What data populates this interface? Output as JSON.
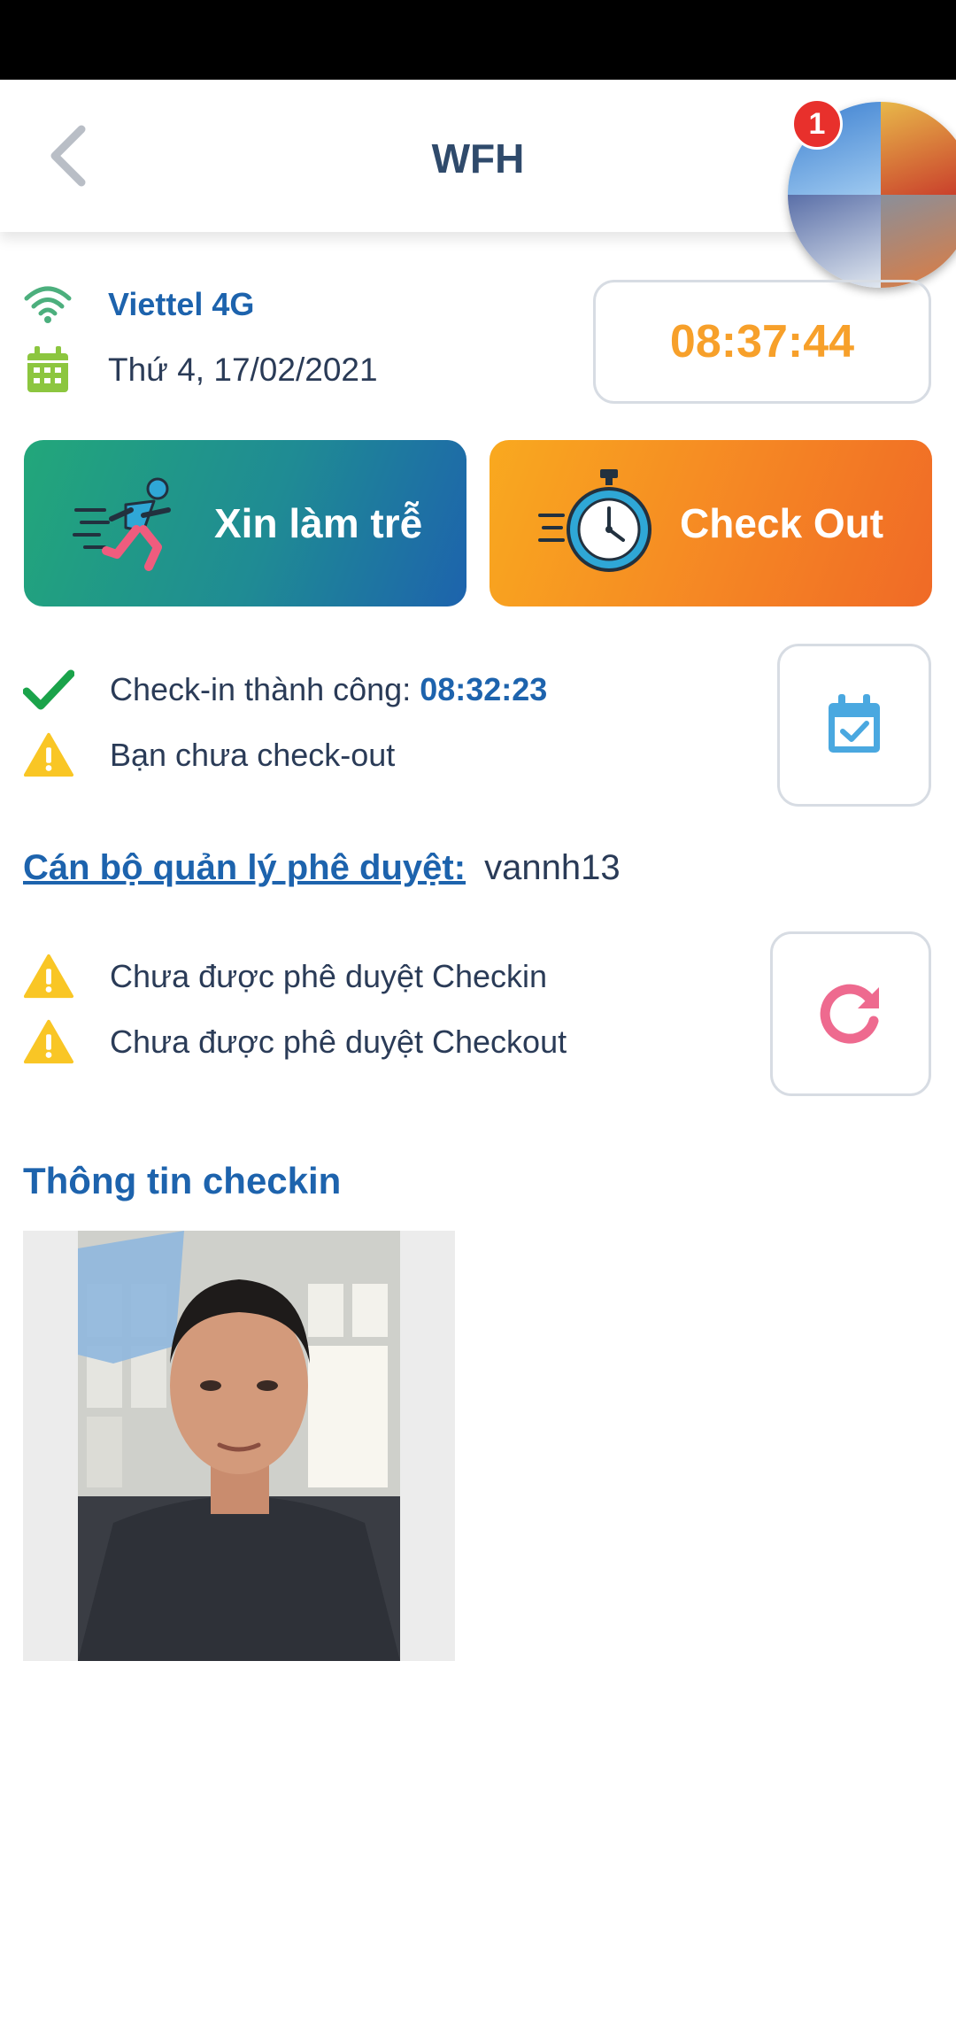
{
  "header": {
    "title": "WFH",
    "notification_count": "1"
  },
  "network": {
    "label": "Viettel 4G"
  },
  "date": {
    "label": "Thứ 4, 17/02/2021"
  },
  "clock": {
    "time": "08:37:44"
  },
  "actions": {
    "late_request_label": "Xin làm trễ",
    "checkout_label": "Check Out"
  },
  "status": {
    "checkin_label": "Check-in thành công:",
    "checkin_time": "08:32:23",
    "checkout_label": "Bạn chưa check-out"
  },
  "approval": {
    "manager_label": "Cán bộ quản lý phê duyệt:",
    "manager_name": "vannh13",
    "checkin_status": "Chưa được phê duyệt Checkin",
    "checkout_status": "Chưa được phê duyệt Checkout"
  },
  "checkin_info": {
    "title": "Thông tin checkin"
  },
  "colors": {
    "primary_blue": "#1d63ad",
    "clock_orange": "#f7a02a",
    "success_green": "#1aa34a",
    "warning_yellow": "#f9c625",
    "refresh_pink": "#ee6a8f"
  }
}
